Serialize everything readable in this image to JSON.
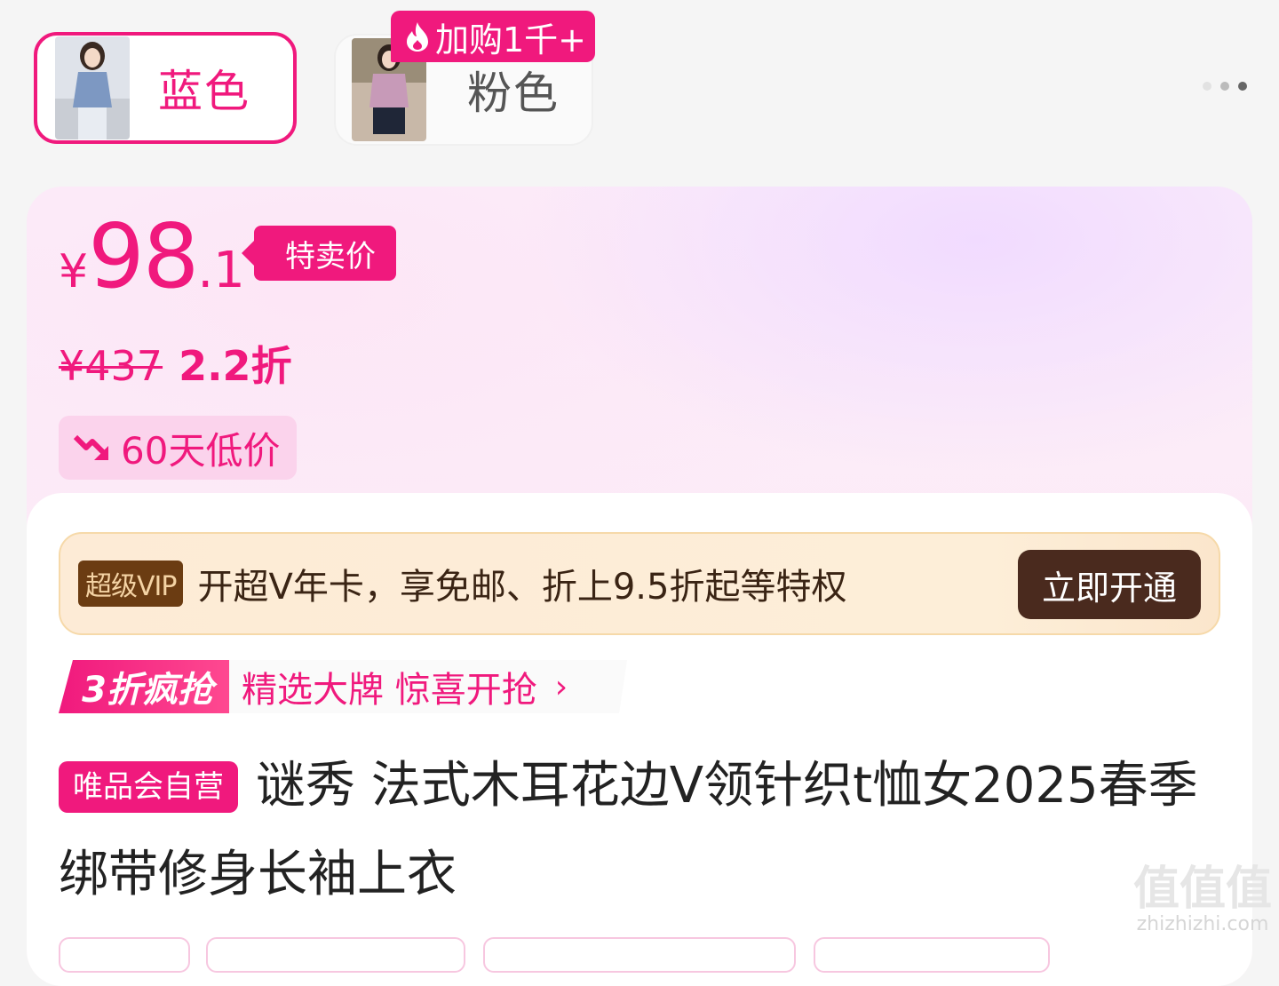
{
  "color_options": [
    {
      "label": "蓝色",
      "selected": true
    },
    {
      "label": "粉色",
      "selected": false,
      "badge": "加购1千+"
    }
  ],
  "price": {
    "currency": "¥",
    "integer": "98",
    "decimal": ".1",
    "tag": "特卖价",
    "original": "¥437",
    "discount": "2.2折",
    "low_price_tag": "60天低价"
  },
  "vip": {
    "badge": "超级VIP",
    "text": "开超V年卡，享免邮、折上9.5折起等特权",
    "button": "立即开通"
  },
  "promo": {
    "badge": "3折疯抢",
    "text": "精选大牌 惊喜开抢"
  },
  "product": {
    "self_operated": "唯品会自营",
    "title": "谜秀 法式木耳花边V领针织t恤女2025春季绑带修身长袖上衣"
  },
  "watermark": {
    "text": "值值值",
    "url": "zhizhizhi.com"
  },
  "colors": {
    "accent": "#f0197d",
    "vip_brown": "#4a2a1e"
  }
}
